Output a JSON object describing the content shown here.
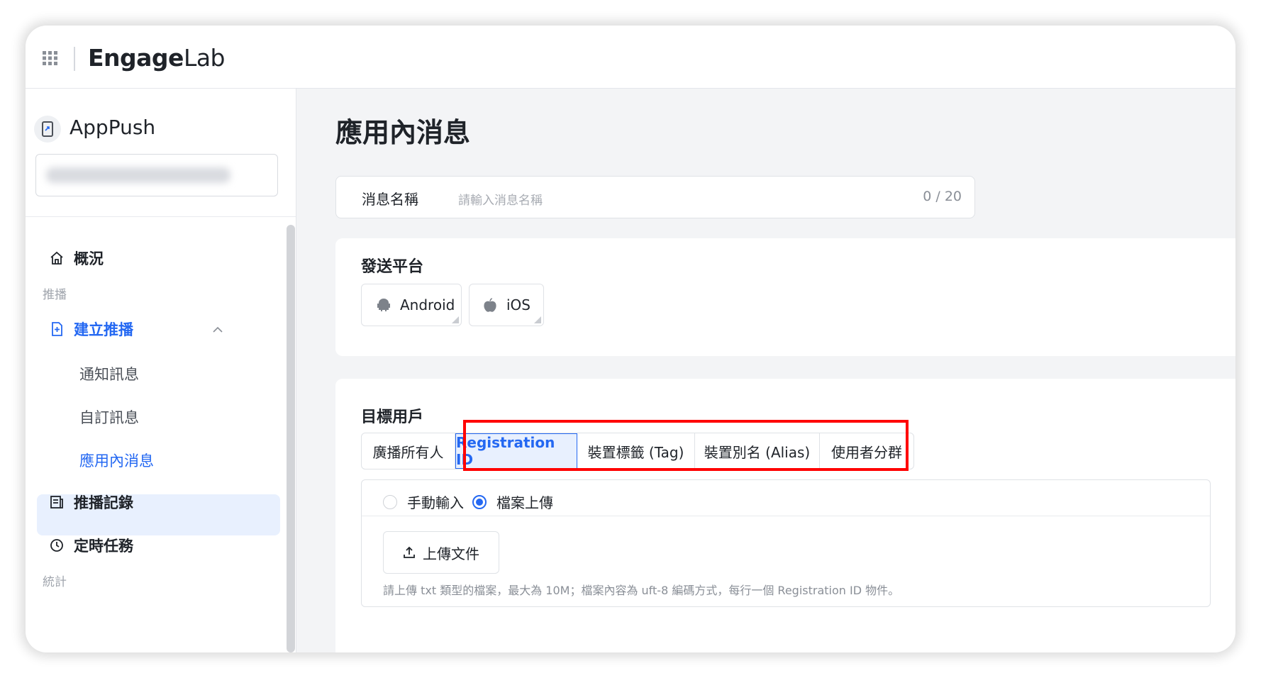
{
  "brand": {
    "logo_engage": "Engage",
    "logo_lab": "Lab"
  },
  "sidebar": {
    "app_name": "AppPush",
    "items": {
      "overview": "概況",
      "section_push": "推播",
      "create_push": "建立推播",
      "notification": "通知訊息",
      "custom_message": "自訂訊息",
      "in_app_message": "應用內消息",
      "push_records": "推播記錄",
      "scheduled_tasks": "定時任務",
      "section_stats": "統計"
    }
  },
  "page": {
    "title": "應用內消息"
  },
  "message_name": {
    "label": "消息名稱",
    "placeholder": "請輸入消息名稱",
    "count": "0 / 20"
  },
  "platform": {
    "title": "發送平台",
    "android": "Android",
    "ios": "iOS"
  },
  "target": {
    "title": "目標用戶",
    "tabs": [
      {
        "label": "廣播所有人"
      },
      {
        "label": "Registration ID",
        "active": true
      },
      {
        "label": "裝置標籤 (Tag)"
      },
      {
        "label": "裝置別名 (Alias)"
      },
      {
        "label": "使用者分群"
      }
    ],
    "input_mode": {
      "manual": "手動輸入",
      "file": "檔案上傳",
      "selected": "file"
    },
    "upload_label": "上傳文件",
    "hint": "請上傳 txt 類型的檔案，最大為 10M；檔案內容為 uft-8 編碼方式，每行一個 Registration ID 物件。"
  },
  "colors": {
    "accent": "#2468f2",
    "highlight": "#ff0000",
    "active_bg": "#e8f0fe"
  },
  "icons": [
    "apps-grid-icon",
    "app-phone-icon",
    "home-icon",
    "file-plus-icon",
    "chevron-up-icon",
    "list-icon",
    "clock-icon",
    "android-icon",
    "apple-icon",
    "upload-icon"
  ]
}
